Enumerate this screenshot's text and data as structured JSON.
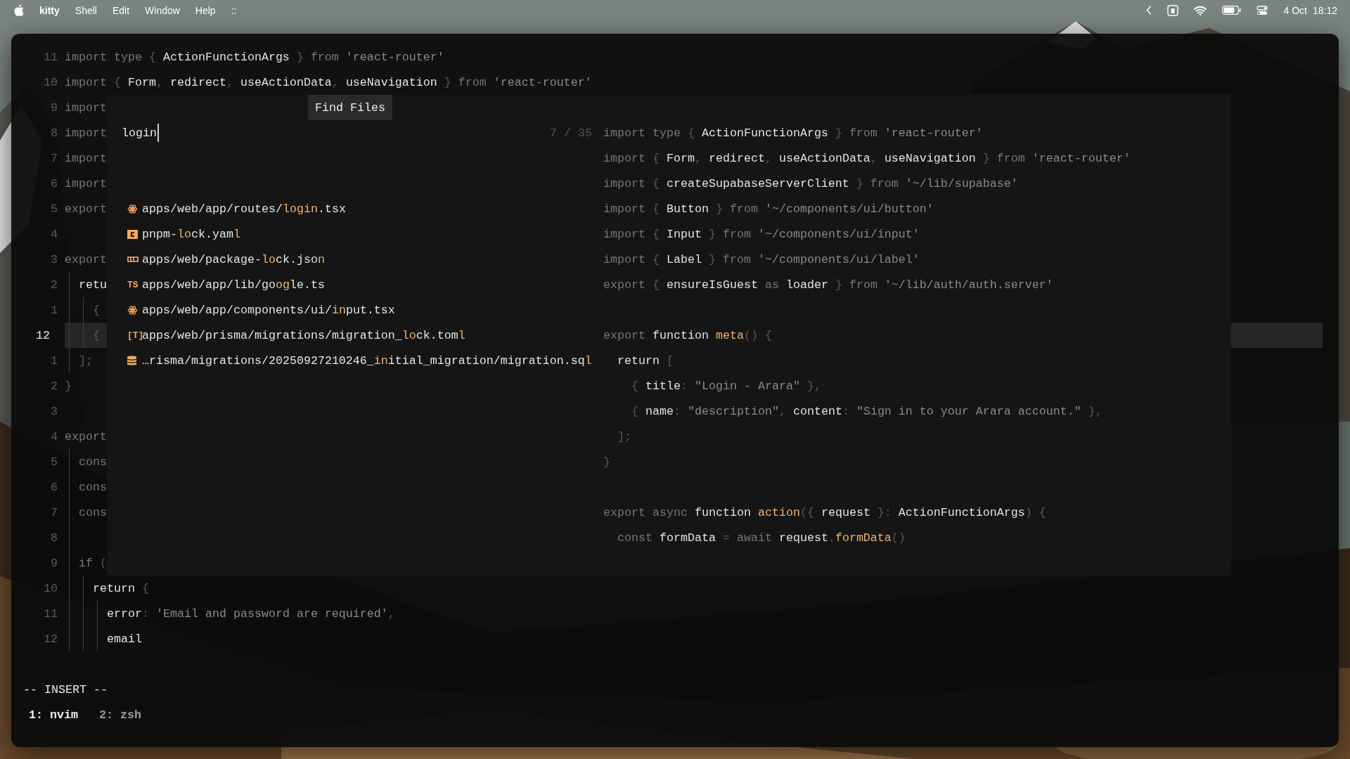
{
  "menubar": {
    "app": "kitty",
    "menus": [
      "Shell",
      "Edit",
      "Window",
      "Help",
      "::"
    ],
    "date": "4 Oct",
    "time": "18:12"
  },
  "editor": {
    "lines": [
      {
        "number": "11",
        "current": false,
        "tokens": [
          {
            "kind": "k",
            "text": "import type "
          },
          {
            "kind": "p",
            "text": "{ "
          },
          {
            "kind": "i",
            "text": "ActionFunctionArgs"
          },
          {
            "kind": "p",
            "text": " } "
          },
          {
            "kind": "k",
            "text": "from "
          },
          {
            "kind": "s",
            "text": "'react-router'"
          }
        ]
      },
      {
        "number": "10",
        "current": false,
        "tokens": [
          {
            "kind": "k",
            "text": "import "
          },
          {
            "kind": "p",
            "text": "{ "
          },
          {
            "kind": "i",
            "text": "Form"
          },
          {
            "kind": "p",
            "text": ", "
          },
          {
            "kind": "i",
            "text": "redirect"
          },
          {
            "kind": "p",
            "text": ", "
          },
          {
            "kind": "i",
            "text": "useActionData"
          },
          {
            "kind": "p",
            "text": ", "
          },
          {
            "kind": "i",
            "text": "useNavigation"
          },
          {
            "kind": "p",
            "text": " } "
          },
          {
            "kind": "k",
            "text": "from "
          },
          {
            "kind": "s",
            "text": "'react-router'"
          }
        ]
      },
      {
        "number": "9",
        "current": false,
        "tokens": [
          {
            "kind": "k",
            "text": "import"
          }
        ]
      },
      {
        "number": "8",
        "current": false,
        "tokens": [
          {
            "kind": "k",
            "text": "import"
          }
        ]
      },
      {
        "number": "7",
        "current": false,
        "tokens": [
          {
            "kind": "k",
            "text": "import"
          }
        ]
      },
      {
        "number": "6",
        "current": false,
        "tokens": [
          {
            "kind": "k",
            "text": "import"
          }
        ]
      },
      {
        "number": "5",
        "current": false,
        "tokens": [
          {
            "kind": "k",
            "text": "export"
          }
        ]
      },
      {
        "number": "4",
        "current": false
      },
      {
        "number": "3",
        "current": false,
        "tokens": [
          {
            "kind": "k",
            "text": "export"
          }
        ]
      },
      {
        "number": "2",
        "current": false,
        "tokens": [
          {
            "kind": "g"
          },
          {
            "kind": "i",
            "text": "retu"
          }
        ]
      },
      {
        "number": "1",
        "current": false,
        "tokens": [
          {
            "kind": "g"
          },
          {
            "kind": "g"
          },
          {
            "kind": "p",
            "text": "{"
          }
        ]
      },
      {
        "number": "12",
        "current": true,
        "tokens": [
          {
            "kind": "g"
          },
          {
            "kind": "g"
          },
          {
            "kind": "p",
            "text": "{"
          }
        ]
      },
      {
        "number": "1",
        "current": false,
        "tokens": [
          {
            "kind": "g"
          },
          {
            "kind": "p",
            "text": "];"
          }
        ]
      },
      {
        "number": "2",
        "current": false,
        "tokens": [
          {
            "kind": "p",
            "text": "}"
          }
        ]
      },
      {
        "number": "3",
        "current": false
      },
      {
        "number": "4",
        "current": false,
        "tokens": [
          {
            "kind": "k",
            "text": "export"
          }
        ]
      },
      {
        "number": "5",
        "current": false,
        "tokens": [
          {
            "kind": "g"
          },
          {
            "kind": "k",
            "text": "cons"
          }
        ]
      },
      {
        "number": "6",
        "current": false,
        "tokens": [
          {
            "kind": "g"
          },
          {
            "kind": "k",
            "text": "cons"
          }
        ]
      },
      {
        "number": "7",
        "current": false,
        "tokens": [
          {
            "kind": "g"
          },
          {
            "kind": "k",
            "text": "cons"
          }
        ]
      },
      {
        "number": "8",
        "current": false,
        "tokens": [
          {
            "kind": "g"
          }
        ]
      },
      {
        "number": "9",
        "current": false,
        "tokens": [
          {
            "kind": "g"
          },
          {
            "kind": "k",
            "text": "if "
          },
          {
            "kind": "p",
            "text": "("
          }
        ]
      },
      {
        "number": "10",
        "current": false,
        "tokens": [
          {
            "kind": "g"
          },
          {
            "kind": "g"
          },
          {
            "kind": "i",
            "text": "return "
          },
          {
            "kind": "p",
            "text": "{"
          }
        ]
      },
      {
        "number": "11",
        "current": false,
        "tokens": [
          {
            "kind": "g"
          },
          {
            "kind": "g"
          },
          {
            "kind": "g"
          },
          {
            "kind": "i",
            "text": "error"
          },
          {
            "kind": "p",
            "text": ": "
          },
          {
            "kind": "s",
            "text": "'Email and password are required'"
          },
          {
            "kind": "p",
            "text": ","
          }
        ]
      },
      {
        "number": "12",
        "current": false,
        "tokens": [
          {
            "kind": "g"
          },
          {
            "kind": "g"
          },
          {
            "kind": "g"
          },
          {
            "kind": "i",
            "text": "email"
          }
        ]
      }
    ]
  },
  "picker": {
    "title": "Find Files",
    "query": "login",
    "count": "7 / 35",
    "results": [
      {
        "kind": "react",
        "parts": [
          {
            "text": "apps/web/app/routes/",
            "match": false
          },
          {
            "text": "login",
            "match": true
          },
          {
            "text": ".tsx",
            "match": false
          }
        ]
      },
      {
        "kind": "yaml",
        "parts": [
          {
            "text": "pnpm-",
            "match": false
          },
          {
            "text": "lo",
            "match": true
          },
          {
            "text": "ck.yam",
            "match": false
          },
          {
            "text": "l",
            "match": true
          }
        ]
      },
      {
        "kind": "json",
        "parts": [
          {
            "text": "apps/web/package-",
            "match": false
          },
          {
            "text": "lo",
            "match": true
          },
          {
            "text": "ck.jso",
            "match": false
          },
          {
            "text": "n",
            "match": true
          }
        ]
      },
      {
        "kind": "glyph",
        "glyph": "TS",
        "parts": [
          {
            "text": "apps/web/app/lib/go",
            "match": false
          },
          {
            "text": "og",
            "match": true
          },
          {
            "text": "le.ts",
            "match": false
          }
        ]
      },
      {
        "kind": "react",
        "parts": [
          {
            "text": "apps/web/app/components/ui/",
            "match": false
          },
          {
            "text": "in",
            "match": true
          },
          {
            "text": "put.tsx",
            "match": false
          }
        ]
      },
      {
        "kind": "glyph",
        "glyph": "[T]",
        "parts": [
          {
            "text": "apps/web/prisma/migrations/migration_",
            "match": false
          },
          {
            "text": "lo",
            "match": true
          },
          {
            "text": "ck.tom",
            "match": false
          },
          {
            "text": "l",
            "match": true
          }
        ]
      },
      {
        "kind": "db",
        "parts": [
          {
            "text": "…risma/migrations/20250927210246_",
            "match": false
          },
          {
            "text": "in",
            "match": true
          },
          {
            "text": "itial_migration/migration.sq",
            "match": false
          },
          {
            "text": "l",
            "match": true
          }
        ]
      }
    ],
    "preview_blocks": [
      {
        "lines": [
          {
            "tokens": [
              {
                "kind": "k",
                "text": "import type "
              },
              {
                "kind": "p",
                "text": "{ "
              },
              {
                "kind": "i",
                "text": "ActionFunctionArgs"
              },
              {
                "kind": "p",
                "text": " } "
              },
              {
                "kind": "k",
                "text": "from "
              },
              {
                "kind": "s",
                "text": "'react-router'"
              }
            ]
          },
          {
            "tokens": [
              {
                "kind": "k",
                "text": "import "
              },
              {
                "kind": "p",
                "text": "{ "
              },
              {
                "kind": "i",
                "text": "Form"
              },
              {
                "kind": "p",
                "text": ", "
              },
              {
                "kind": "i",
                "text": "redirect"
              },
              {
                "kind": "p",
                "text": ", "
              },
              {
                "kind": "i",
                "text": "useActionData"
              },
              {
                "kind": "p",
                "text": ", "
              },
              {
                "kind": "i",
                "text": "useNavigation"
              },
              {
                "kind": "p",
                "text": " } "
              },
              {
                "kind": "k",
                "text": "from "
              },
              {
                "kind": "s",
                "text": "'react-router'"
              }
            ]
          },
          {
            "tokens": [
              {
                "kind": "k",
                "text": "import "
              },
              {
                "kind": "p",
                "text": "{ "
              },
              {
                "kind": "i",
                "text": "createSupabaseServerClient"
              },
              {
                "kind": "p",
                "text": " } "
              },
              {
                "kind": "k",
                "text": "from "
              },
              {
                "kind": "s",
                "text": "'~/lib/supabase'"
              }
            ]
          },
          {
            "tokens": [
              {
                "kind": "k",
                "text": "import "
              },
              {
                "kind": "p",
                "text": "{ "
              },
              {
                "kind": "i",
                "text": "Button"
              },
              {
                "kind": "p",
                "text": " } "
              },
              {
                "kind": "k",
                "text": "from "
              },
              {
                "kind": "s",
                "text": "'~/components/ui/button'"
              }
            ]
          },
          {
            "tokens": [
              {
                "kind": "k",
                "text": "import "
              },
              {
                "kind": "p",
                "text": "{ "
              },
              {
                "kind": "i",
                "text": "Input"
              },
              {
                "kind": "p",
                "text": " } "
              },
              {
                "kind": "k",
                "text": "from "
              },
              {
                "kind": "s",
                "text": "'~/components/ui/input'"
              }
            ]
          },
          {
            "tokens": [
              {
                "kind": "k",
                "text": "import "
              },
              {
                "kind": "p",
                "text": "{ "
              },
              {
                "kind": "i",
                "text": "Label"
              },
              {
                "kind": "p",
                "text": " } "
              },
              {
                "kind": "k",
                "text": "from "
              },
              {
                "kind": "s",
                "text": "'~/components/ui/label'"
              }
            ]
          },
          {
            "tokens": [
              {
                "kind": "k",
                "text": "export "
              },
              {
                "kind": "p",
                "text": "{ "
              },
              {
                "kind": "i",
                "text": "ensureIsGuest"
              },
              {
                "kind": "k",
                "text": " as "
              },
              {
                "kind": "i",
                "text": "loader"
              },
              {
                "kind": "p",
                "text": " } "
              },
              {
                "kind": "k",
                "text": "from "
              },
              {
                "kind": "s",
                "text": "'~/lib/auth/auth.server'"
              }
            ]
          }
        ]
      },
      {
        "lines": [
          {
            "tokens": [
              {
                "kind": "k",
                "text": "export "
              },
              {
                "kind": "i",
                "text": "function "
              },
              {
                "kind": "f",
                "text": "meta"
              },
              {
                "kind": "p",
                "text": "() {"
              }
            ]
          },
          {
            "tokens": [
              {
                "kind": "i",
                "text": "  return "
              },
              {
                "kind": "p",
                "text": "["
              }
            ]
          },
          {
            "tokens": [
              {
                "kind": "p",
                "text": "    { "
              },
              {
                "kind": "i",
                "text": "title"
              },
              {
                "kind": "p",
                "text": ": "
              },
              {
                "kind": "s",
                "text": "\"Login - Arara\""
              },
              {
                "kind": "p",
                "text": " },"
              }
            ]
          },
          {
            "tokens": [
              {
                "kind": "p",
                "text": "    { "
              },
              {
                "kind": "i",
                "text": "name"
              },
              {
                "kind": "p",
                "text": ": "
              },
              {
                "kind": "s",
                "text": "\"description\""
              },
              {
                "kind": "p",
                "text": ", "
              },
              {
                "kind": "i",
                "text": "content"
              },
              {
                "kind": "p",
                "text": ": "
              },
              {
                "kind": "s",
                "text": "\"Sign in to your Arara account.\""
              },
              {
                "kind": "p",
                "text": " },"
              }
            ]
          },
          {
            "tokens": [
              {
                "kind": "p",
                "text": "  ];"
              }
            ]
          },
          {
            "tokens": [
              {
                "kind": "p",
                "text": "}"
              }
            ]
          }
        ]
      },
      {
        "lines": [
          {
            "tokens": [
              {
                "kind": "k",
                "text": "export async "
              },
              {
                "kind": "i",
                "text": "function "
              },
              {
                "kind": "f",
                "text": "action"
              },
              {
                "kind": "p",
                "text": "({ "
              },
              {
                "kind": "i",
                "text": "request"
              },
              {
                "kind": "p",
                "text": " }: "
              },
              {
                "kind": "i",
                "text": "ActionFunctionArgs"
              },
              {
                "kind": "p",
                "text": ") {"
              }
            ]
          },
          {
            "tokens": [
              {
                "kind": "k",
                "text": "  const "
              },
              {
                "kind": "i",
                "text": "formData"
              },
              {
                "kind": "p",
                "text": " = "
              },
              {
                "kind": "k",
                "text": "await "
              },
              {
                "kind": "i",
                "text": "request"
              },
              {
                "kind": "p",
                "text": "."
              },
              {
                "kind": "f",
                "text": "formData"
              },
              {
                "kind": "p",
                "text": "()"
              }
            ]
          }
        ]
      }
    ]
  },
  "mode": "-- INSERT --",
  "tabs": [
    {
      "label": "1: nvim",
      "selected": true
    },
    {
      "label": "2: zsh",
      "selected": false
    }
  ]
}
